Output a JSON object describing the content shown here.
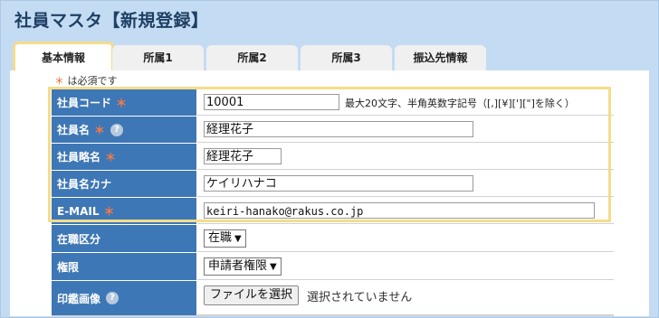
{
  "page_title": "社員マスタ【新規登録】",
  "tabs": [
    {
      "label": "基本情報",
      "active": true
    },
    {
      "label": "所属1"
    },
    {
      "label": "所属2"
    },
    {
      "label": "所属3"
    },
    {
      "label": "振込先情報"
    }
  ],
  "required_note": {
    "marker": "＊",
    "text": "は必須です"
  },
  "form": {
    "employee_code": {
      "label": "社員コード",
      "required": "＊",
      "value": "10001",
      "hint": "最大20文字、半角英数字記号（[,][¥]['][\"]を除く）"
    },
    "employee_name": {
      "label": "社員名",
      "required": "＊",
      "value": "経理花子"
    },
    "employee_short_name": {
      "label": "社員略名",
      "required": "＊",
      "value": "経理花子"
    },
    "employee_name_kana": {
      "label": "社員名カナ",
      "value": "ケイリハナコ"
    },
    "email": {
      "label": "E-MAIL",
      "required": "＊",
      "value": "keiri-hanako@rakus.co.jp"
    },
    "employment_status": {
      "label": "在職区分",
      "selected": "在職"
    },
    "permission": {
      "label": "権限",
      "selected": "申請者権限"
    },
    "seal_image": {
      "label": "印鑑画像",
      "button": "ファイルを選択",
      "status": "選択されていません"
    }
  },
  "icons": {
    "help": "?",
    "chevron": "▼"
  },
  "colors": {
    "label_bg": "#3e77b5",
    "required": "#e86b2b",
    "highlight": "#f5dc8a",
    "background": "#c4dcf3"
  }
}
